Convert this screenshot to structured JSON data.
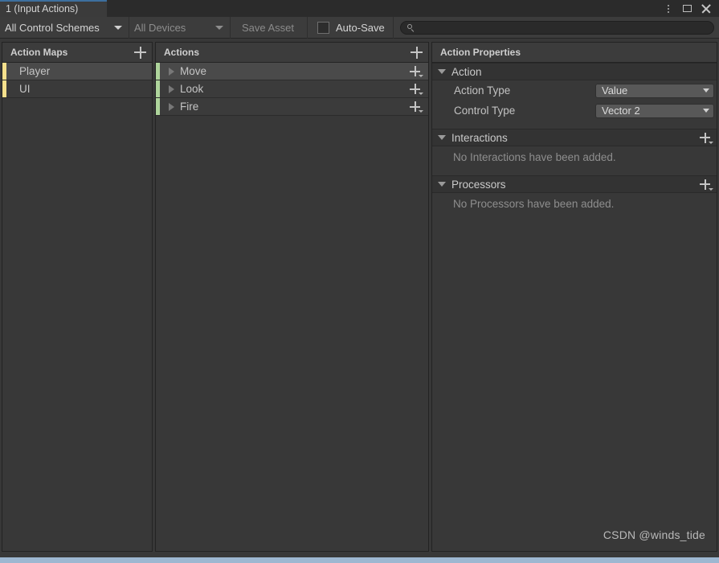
{
  "window": {
    "tab_label": "1 (Input Actions)",
    "controls": {
      "menu": "kebab-menu-icon",
      "maximize": "maximize-icon",
      "close": "close-icon"
    }
  },
  "toolbar": {
    "control_schemes": "All Control Schemes",
    "devices": "All Devices",
    "save_asset": "Save Asset",
    "auto_save": "Auto-Save",
    "auto_save_checked": false,
    "search_value": "",
    "search_placeholder": ""
  },
  "action_maps": {
    "title": "Action Maps",
    "add_label": "+",
    "accent_color": "#F5E08C",
    "items": [
      {
        "label": "Player",
        "selected": true
      },
      {
        "label": "UI",
        "selected": false
      }
    ]
  },
  "actions": {
    "title": "Actions",
    "add_label": "+",
    "accent_color": "#AED49B",
    "items": [
      {
        "label": "Move",
        "selected": true
      },
      {
        "label": "Look",
        "selected": false
      },
      {
        "label": "Fire",
        "selected": false
      }
    ]
  },
  "properties": {
    "title": "Action Properties",
    "action_section": {
      "title": "Action",
      "rows": [
        {
          "label": "Action Type",
          "value": "Value"
        },
        {
          "label": "Control Type",
          "value": "Vector 2"
        }
      ]
    },
    "interactions_section": {
      "title": "Interactions",
      "empty_text": "No Interactions have been added."
    },
    "processors_section": {
      "title": "Processors",
      "empty_text": "No Processors have been added."
    }
  },
  "watermark": "CSDN @winds_tide"
}
